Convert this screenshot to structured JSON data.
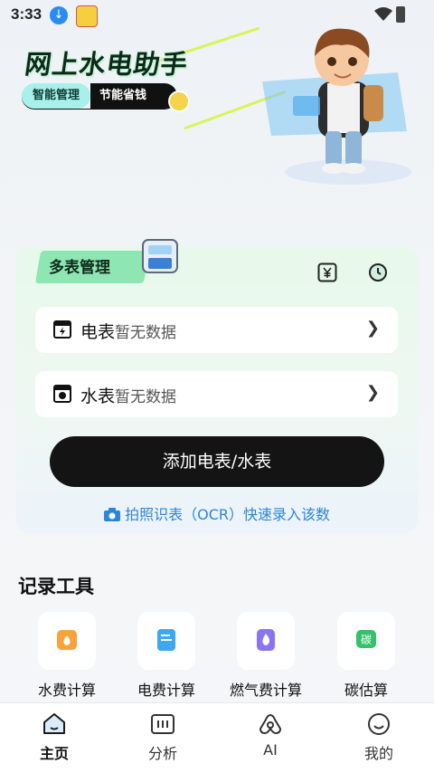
{
  "status_bar": {
    "time": "3:33"
  },
  "hero": {
    "title": "网上水电助手",
    "tags": [
      "智能管理",
      "节能省钱"
    ]
  },
  "meter_card": {
    "badge": "多表管理",
    "rows": [
      {
        "title": "电表",
        "status": "暂无数据"
      },
      {
        "title": "水表",
        "status": "暂无数据"
      }
    ],
    "add_button": "添加电表/水表",
    "ocr_link": "拍照识表（OCR）快速录入该数",
    "accent": "#2b86d8"
  },
  "tools": {
    "title": "记录工具",
    "items": [
      {
        "label": "水费计算",
        "icon": "water-bill-icon",
        "color": "#f7a23b"
      },
      {
        "label": "电费计算",
        "icon": "electric-bill-icon",
        "color": "#3fa7f0"
      },
      {
        "label": "燃气费计算",
        "icon": "gas-bill-icon",
        "color": "#8a74f3"
      },
      {
        "label": "碳估算",
        "icon": "carbon-icon",
        "glyph": "碳",
        "color": "#35c06b"
      }
    ]
  },
  "tabbar": {
    "tabs": [
      {
        "label": "主页",
        "icon": "home-icon",
        "active": true
      },
      {
        "label": "分析",
        "icon": "analysis-icon"
      },
      {
        "label": "AI",
        "icon": "ai-icon"
      },
      {
        "label": "我的",
        "icon": "profile-icon"
      }
    ]
  }
}
